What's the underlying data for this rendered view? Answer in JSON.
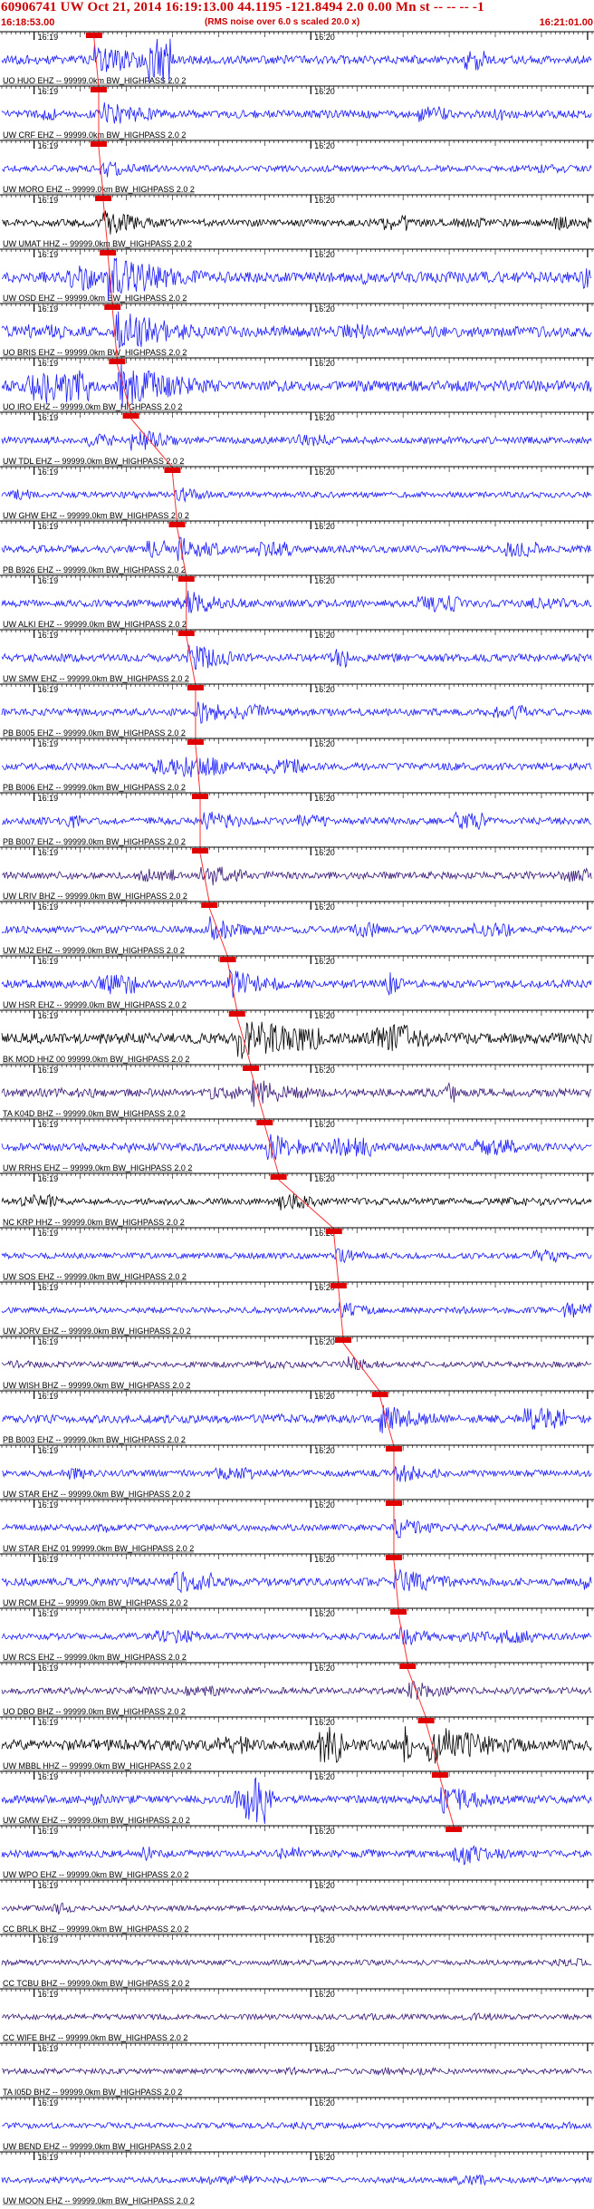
{
  "header": {
    "title": "60906741 UW Oct 21, 2014 16:19:13.00   44.1195 -121.8494  2.0 0.00 Mn st -- -- --   -1",
    "start_time": "16:18:53.00",
    "end_time": "16:21:01.00",
    "noise_note": "(RMS noise over 6.0 s scaled 20.0 x)"
  },
  "colors": {
    "text": "#cc0000",
    "pick_box": "#e00000",
    "pick_line": "#ff3030",
    "axis": "#000000",
    "trace_blue": "#1a1aff",
    "trace_black": "#000000",
    "trace_purple": "#3a1a78"
  },
  "chart_data": {
    "type": "line",
    "title": "60906741 UW Oct 21, 2014 16:19:13.00   44.1195 -121.8494  2.0 0.00 Mn st -- -- --   -1",
    "x_range": [
      "16:18:53.00",
      "16:21:01.00"
    ],
    "x_ticks": [
      "16:19",
      "16:20"
    ],
    "x_unit": "time",
    "channels": [
      {
        "label": "UO HUO EHZ -- 99999.0km BW_HIGHPASS  2.0  2",
        "pick": "16:19:13",
        "color": "blue",
        "amp": 0.7
      },
      {
        "label": "UW CRF EHZ -- 99999.0km BW_HIGHPASS  2.0  2",
        "pick": "16:19:14",
        "color": "blue",
        "amp": 0.6
      },
      {
        "label": "UW MORO EHZ -- 99999.0km BW_HIGHPASS  2.0  2",
        "pick": "16:19:14",
        "color": "blue",
        "amp": 0.4
      },
      {
        "label": "UW UMAT HHZ -- 99999.0km BW_HIGHPASS  2.0  2",
        "pick": "16:19:15",
        "color": "black",
        "amp": 0.5
      },
      {
        "label": "UW OSD EHZ -- 99999.0km BW_HIGHPASS  2.0  2",
        "pick": "16:19:16",
        "color": "blue",
        "amp": 1.0
      },
      {
        "label": "UO BRIS EHZ -- 99999.0km BW_HIGHPASS  2.0  2",
        "pick": "16:19:17",
        "color": "blue",
        "amp": 1.0
      },
      {
        "label": "UO IRO EHZ -- 99999.0km BW_HIGHPASS  2.0  2",
        "pick": "16:19:18",
        "color": "blue",
        "amp": 1.0
      },
      {
        "label": "UW TDL EHZ -- 99999.0km BW_HIGHPASS  2.0  2",
        "pick": "16:19:21",
        "color": "blue",
        "amp": 0.5
      },
      {
        "label": "UW GHW EHZ -- 99999.0km BW_HIGHPASS  2.0  2",
        "pick": "16:19:30",
        "color": "blue",
        "amp": 0.3
      },
      {
        "label": "PB B926 EHZ -- 99999.0km BW_HIGHPASS  2.0  2",
        "pick": "16:19:31",
        "color": "blue",
        "amp": 0.5
      },
      {
        "label": "UW ALKI EHZ -- 99999.0km BW_HIGHPASS  2.0  2",
        "pick": "16:19:33",
        "color": "blue",
        "amp": 0.5
      },
      {
        "label": "UW SMW EHZ -- 99999.0km BW_HIGHPASS  2.0  2",
        "pick": "16:19:33",
        "color": "blue",
        "amp": 0.6
      },
      {
        "label": "PB B005 EHZ -- 99999.0km BW_HIGHPASS  2.0  2",
        "pick": "16:19:35",
        "color": "blue",
        "amp": 0.5
      },
      {
        "label": "PB B006 EHZ -- 99999.0km BW_HIGHPASS  2.0  2",
        "pick": "16:19:35",
        "color": "blue",
        "amp": 0.5
      },
      {
        "label": "PB B007 EHZ -- 99999.0km BW_HIGHPASS  2.0  2",
        "pick": "16:19:36",
        "color": "blue",
        "amp": 0.5
      },
      {
        "label": "UW LRIV BHZ -- 99999.0km BW_HIGHPASS  2.0  2",
        "pick": "16:19:36",
        "color": "purple",
        "amp": 0.5
      },
      {
        "label": "UW MJ2 EHZ -- 99999.0km BW_HIGHPASS  2.0  2",
        "pick": "16:19:38",
        "color": "blue",
        "amp": 0.5
      },
      {
        "label": "UW HSR EHZ -- 99999.0km BW_HIGHPASS  2.0  2",
        "pick": "16:19:42",
        "color": "blue",
        "amp": 0.6
      },
      {
        "label": "BK MOD HHZ 00 99999.0km BW_HIGHPASS  2.0  2",
        "pick": "16:19:44",
        "color": "black",
        "amp": 1.0
      },
      {
        "label": "TA K04D BHZ -- 99999.0km BW_HIGHPASS  2.0  2",
        "pick": "16:19:47",
        "color": "purple",
        "amp": 0.6
      },
      {
        "label": "UW RRHS EHZ -- 99999.0km BW_HIGHPASS  2.0  2",
        "pick": "16:19:50",
        "color": "blue",
        "amp": 0.6
      },
      {
        "label": "NC KRP HHZ -- 99999.0km BW_HIGHPASS  2.0  2",
        "pick": "16:19:53",
        "color": "black",
        "amp": 0.4
      },
      {
        "label": "UW SOS EHZ -- 99999.0km BW_HIGHPASS  2.0  2",
        "pick": "16:20:05",
        "color": "blue",
        "amp": 0.3
      },
      {
        "label": "UW JORV EHZ -- 99999.0km BW_HIGHPASS  2.0  2",
        "pick": "16:20:06",
        "color": "blue",
        "amp": 0.3
      },
      {
        "label": "UW WISH BHZ -- 99999.0km BW_HIGHPASS  2.0  2",
        "pick": "16:20:07",
        "color": "purple",
        "amp": 0.3
      },
      {
        "label": "PB B003 EHZ -- 99999.0km BW_HIGHPASS  2.0  2",
        "pick": "16:20:15",
        "color": "blue",
        "amp": 0.6
      },
      {
        "label": "UW STAR EHZ -- 99999.0km BW_HIGHPASS  2.0  2",
        "pick": "16:20:18",
        "color": "blue",
        "amp": 0.4
      },
      {
        "label": "UW STAR EHZ 01 99999.0km BW_HIGHPASS  2.0  2",
        "pick": "16:20:18",
        "color": "blue",
        "amp": 0.4
      },
      {
        "label": "UW RCM EHZ -- 99999.0km BW_HIGHPASS  2.0  2",
        "pick": "16:20:18",
        "color": "blue",
        "amp": 0.6
      },
      {
        "label": "UW RCS EHZ -- 99999.0km BW_HIGHPASS  2.0  2",
        "pick": "16:20:19",
        "color": "blue",
        "amp": 0.4
      },
      {
        "label": "UO DBO BHZ -- 99999.0km BW_HIGHPASS  2.0  2",
        "pick": "16:20:21",
        "color": "purple",
        "amp": 0.4
      },
      {
        "label": "UW MBBL HHZ -- 99999.0km BW_HIGHPASS  2.0  2",
        "pick": "16:20:25",
        "color": "black",
        "amp": 1.0
      },
      {
        "label": "UW GMW EHZ -- 99999.0km BW_HIGHPASS  2.0  2",
        "pick": "16:20:28",
        "color": "blue",
        "amp": 0.6
      },
      {
        "label": "UW WPO EHZ -- 99999.0km BW_HIGHPASS  2.0  2",
        "pick": "16:20:31",
        "color": "blue",
        "amp": 0.5
      },
      {
        "label": "CC BRLK BHZ -- 99999.0km BW_HIGHPASS  2.0  2",
        "pick": "",
        "color": "purple",
        "amp": 0.25
      },
      {
        "label": "CC TCBU BHZ -- 99999.0km BW_HIGHPASS  2.0  2",
        "pick": "",
        "color": "purple",
        "amp": 0.25
      },
      {
        "label": "CC WIFE BHZ -- 99999.0km BW_HIGHPASS  2.0  2",
        "pick": "",
        "color": "purple",
        "amp": 0.25
      },
      {
        "label": "TA I05D BHZ -- 99999.0km BW_HIGHPASS  2.0  2",
        "pick": "",
        "color": "purple",
        "amp": 0.25
      },
      {
        "label": "UW BEND EHZ -- 99999.0km BW_HIGHPASS  2.0  2",
        "pick": "",
        "color": "blue",
        "amp": 0.3
      },
      {
        "label": "UW MOON EHZ -- 99999.0km BW_HIGHPASS  2.0  2",
        "pick": "",
        "color": "blue",
        "amp": 0.3
      }
    ]
  }
}
